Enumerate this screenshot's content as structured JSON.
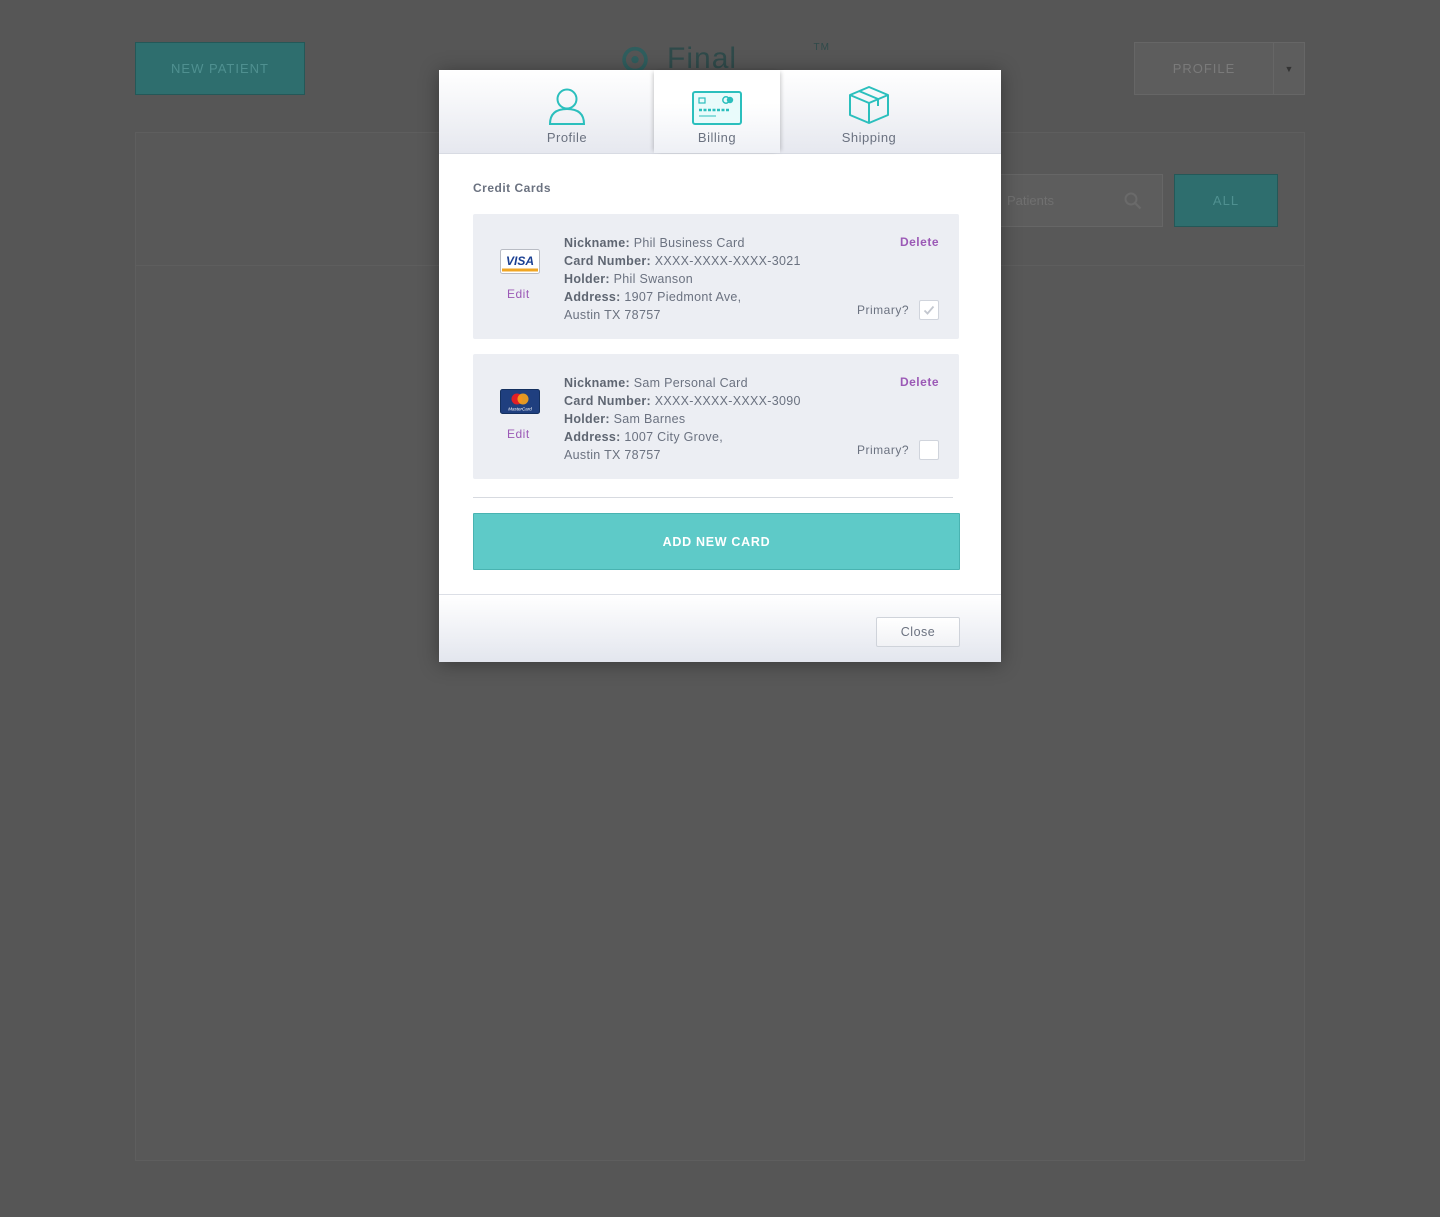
{
  "background": {
    "new_patient_label": "NEW PATIENT",
    "logo_text": "Final Wires",
    "logo_tm": "TM",
    "profile_label": "PROFILE",
    "search_placeholder": "Patients",
    "all_label": "ALL"
  },
  "modal": {
    "tabs": [
      {
        "label": "Profile",
        "icon": "person-icon"
      },
      {
        "label": "Billing",
        "icon": "credit-card-icon",
        "active": true
      },
      {
        "label": "Shipping",
        "icon": "box-icon"
      }
    ],
    "section_title": "Credit Cards",
    "cards": [
      {
        "brand": "VISA",
        "edit_label": "Edit",
        "nickname_label": "Nickname:",
        "nickname": "Phil Business Card",
        "number_label": "Card Number:",
        "number": "XXXX-XXXX-XXXX-3021",
        "holder_label": "Holder:",
        "holder": "Phil Swanson",
        "address_label": "Address:",
        "address_line1": "1907 Piedmont Ave,",
        "address_line2": "Austin TX 78757",
        "delete_label": "Delete",
        "primary_label": "Primary?",
        "primary": true
      },
      {
        "brand": "MasterCard",
        "edit_label": "Edit",
        "nickname_label": "Nickname:",
        "nickname": "Sam Personal Card",
        "number_label": "Card Number:",
        "number": "XXXX-XXXX-XXXX-3090",
        "holder_label": "Holder:",
        "holder": "Sam Barnes",
        "address_label": "Address:",
        "address_line1": "1007 City Grove,",
        "address_line2": "Austin TX 78757",
        "delete_label": "Delete",
        "primary_label": "Primary?",
        "primary": false
      }
    ],
    "add_button_label": "ADD NEW CARD",
    "close_label": "Close"
  },
  "colors": {
    "accent": "#5ecac8",
    "link": "#9b59b6",
    "icon": "#2bbfbd"
  }
}
